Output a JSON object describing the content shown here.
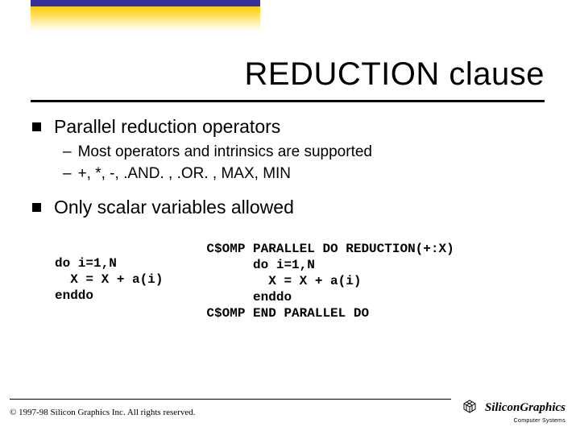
{
  "title": "REDUCTION clause",
  "bullets": {
    "b1": "Parallel reduction operators",
    "b1_1": "Most operators and intrinsics are supported",
    "b1_2": "+, *,  -, .AND. , .OR. , MAX, MIN",
    "b2": "Only scalar variables allowed"
  },
  "code_left": "do i=1,N\n  X = X + a(i)\nenddo",
  "code_right": "C$OMP PARALLEL DO REDUCTION(+:X)\n      do i=1,N\n        X = X + a(i)\n      enddo\nC$OMP END PARALLEL DO",
  "footer": {
    "copyright": "© 1997-98 Silicon Graphics Inc. All rights reserved.",
    "brand": "SiliconGraphics",
    "brand_sub": "Computer Systems"
  }
}
